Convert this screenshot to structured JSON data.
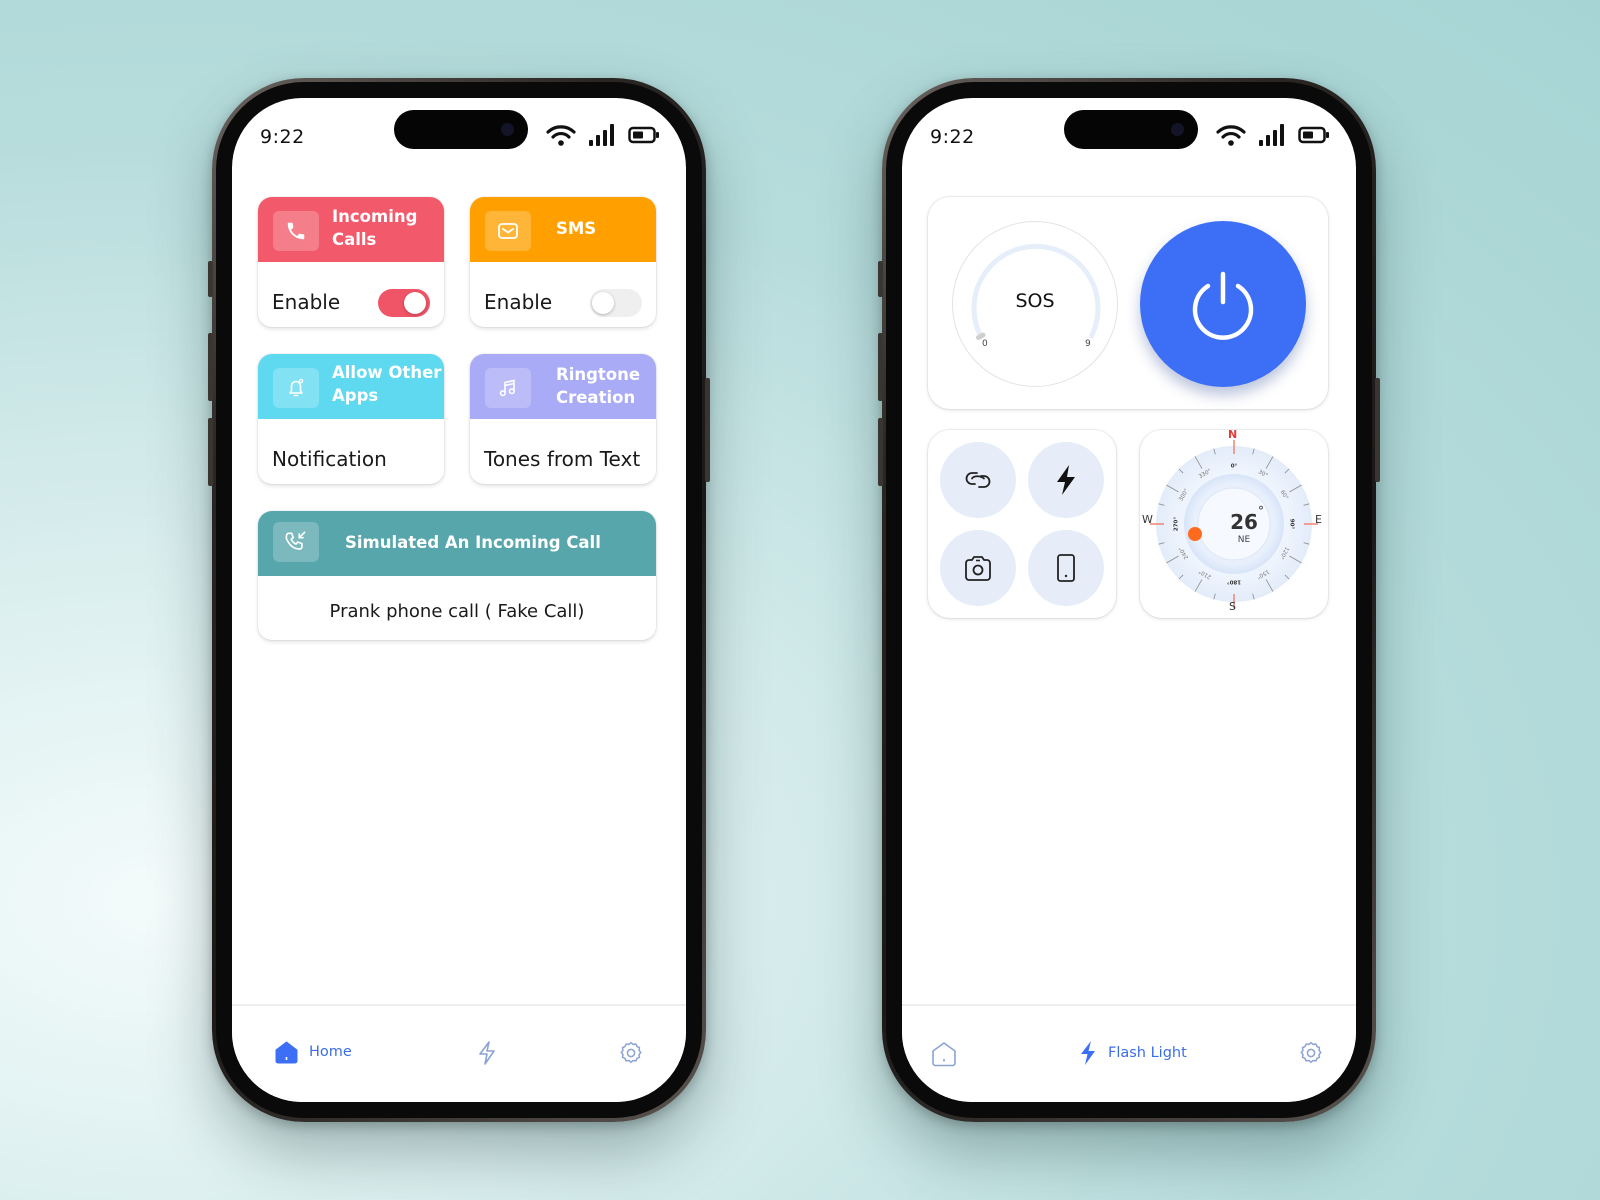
{
  "status_bar": {
    "time": "9:22"
  },
  "left_phone": {
    "cards": [
      {
        "title": "Incoming Calls",
        "title_line1": "Incoming",
        "title_line2": "Calls",
        "icon": "phone-icon",
        "color": "#f25a6b",
        "label": "Enable",
        "toggle": true
      },
      {
        "title": "SMS",
        "icon": "mail-icon",
        "color": "#ffa000",
        "label": "Enable",
        "toggle": false
      },
      {
        "title": "Allow Other Apps",
        "title_line1": "Allow Other",
        "title_line2": "Apps",
        "icon": "bell-icon",
        "color": "#5fd9ef",
        "label": "Notification"
      },
      {
        "title": "Ringtone Creation",
        "title_line1": "Ringtone",
        "title_line2": "Creation",
        "icon": "music-note-icon",
        "color": "#a9abf7",
        "label": "Tones from Text"
      },
      {
        "title": "Simulated An Incoming Call",
        "icon": "incoming-call-icon",
        "color": "#57a6ac",
        "label": "Prank phone call ( Fake Call)"
      }
    ],
    "nav": [
      {
        "label": "Home",
        "icon": "home-icon",
        "active": true
      },
      {
        "label": "",
        "icon": "flash-icon",
        "active": false
      },
      {
        "label": "",
        "icon": "settings-icon",
        "active": false
      }
    ]
  },
  "right_phone": {
    "sos": {
      "label": "SOS",
      "min": "0",
      "max": "9",
      "level": 0
    },
    "power": {
      "icon": "power-icon",
      "color": "#3d6ef6"
    },
    "quick_actions": [
      {
        "icon": "link-icon"
      },
      {
        "icon": "flash-icon"
      },
      {
        "icon": "camera-icon"
      },
      {
        "icon": "phone-device-icon"
      }
    ],
    "compass": {
      "heading": "26",
      "degree_symbol": "°",
      "direction": "NE",
      "cardinals": {
        "n": "N",
        "e": "E",
        "s": "S",
        "w": "W"
      },
      "ticks": [
        "0°",
        "30°",
        "60°",
        "90°",
        "120°",
        "150°",
        "180°",
        "210°",
        "240°",
        "270°",
        "300°",
        "330°"
      ]
    },
    "nav": [
      {
        "label": "",
        "icon": "home-icon",
        "active": false
      },
      {
        "label": "Flash Light",
        "icon": "flash-icon",
        "active": true
      },
      {
        "label": "",
        "icon": "settings-icon",
        "active": false
      }
    ]
  }
}
